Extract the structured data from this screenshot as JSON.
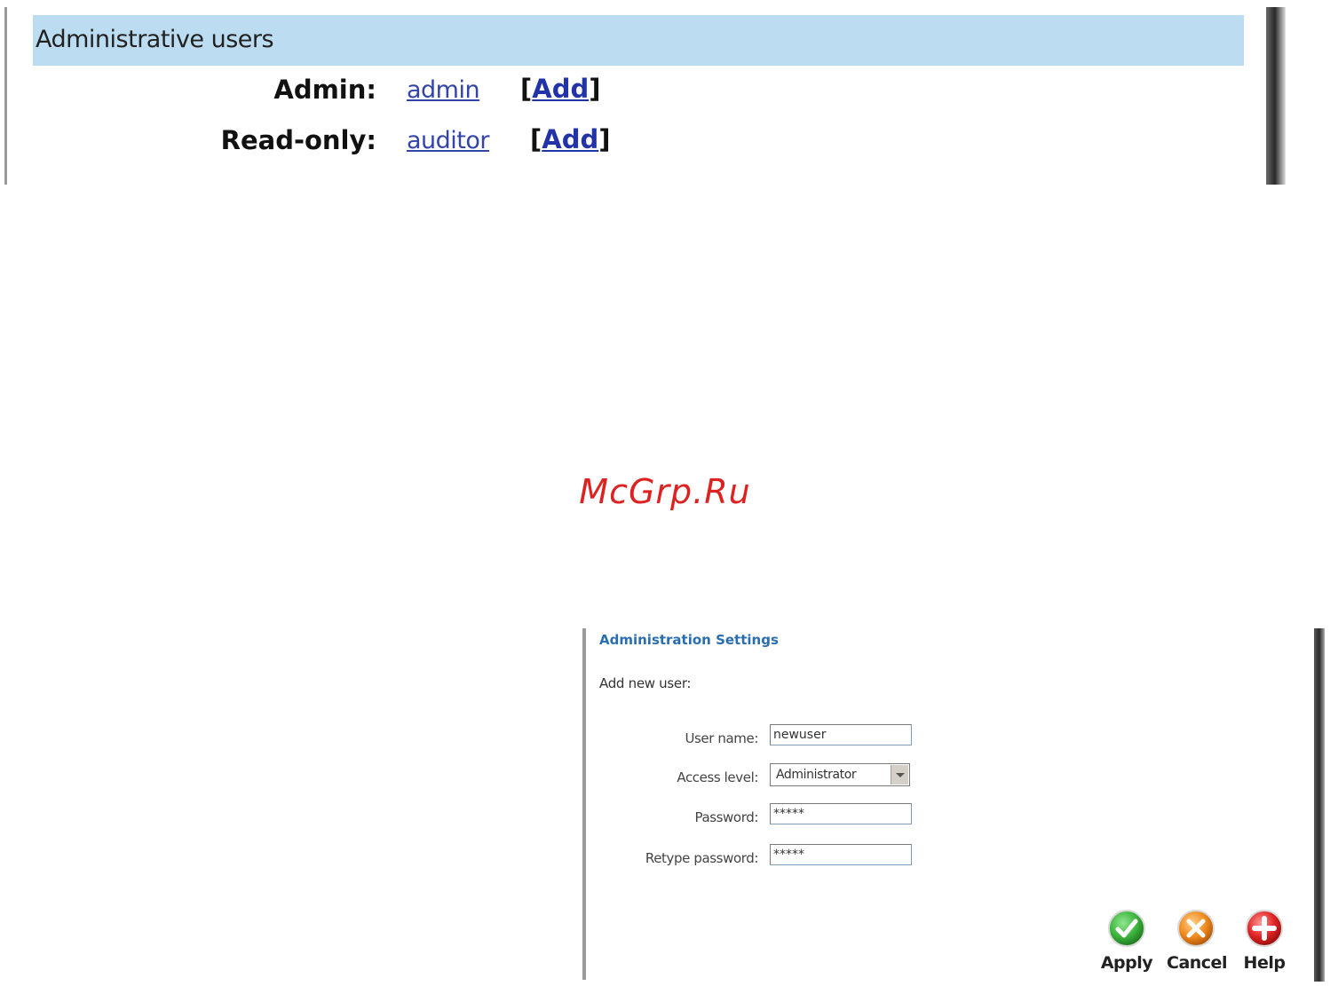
{
  "admin_users": {
    "header": "Administrative users",
    "rows": [
      {
        "label": "Admin:",
        "user": "admin",
        "add_open": "[",
        "add": "Add",
        "add_close": "]"
      },
      {
        "label": "Read-only:",
        "user": "auditor",
        "add_open": "[",
        "add": "Add",
        "add_close": "]"
      }
    ]
  },
  "watermark": "McGrp.Ru",
  "settings": {
    "title": "Administration Settings",
    "subtitle": "Add new user:",
    "fields": {
      "username_label": "User name:",
      "username_value": "newuser",
      "access_label": "Access level:",
      "access_value": "Administrator",
      "password_label": "Password:",
      "password_value": "*****",
      "retype_label": "Retype password:",
      "retype_value": "*****"
    },
    "buttons": {
      "apply": "Apply",
      "cancel": "Cancel",
      "help": "Help"
    }
  },
  "colors": {
    "header_bg": "#bcdcf2",
    "link": "#3344aa",
    "title_blue": "#2a6eb0",
    "watermark": "#dd2222",
    "apply_green": "#3db53d",
    "cancel_orange": "#f08a1e",
    "help_red": "#e02424"
  },
  "icons": {
    "apply": "check-icon",
    "cancel": "cancel-x-icon",
    "help": "help-plus-icon"
  }
}
